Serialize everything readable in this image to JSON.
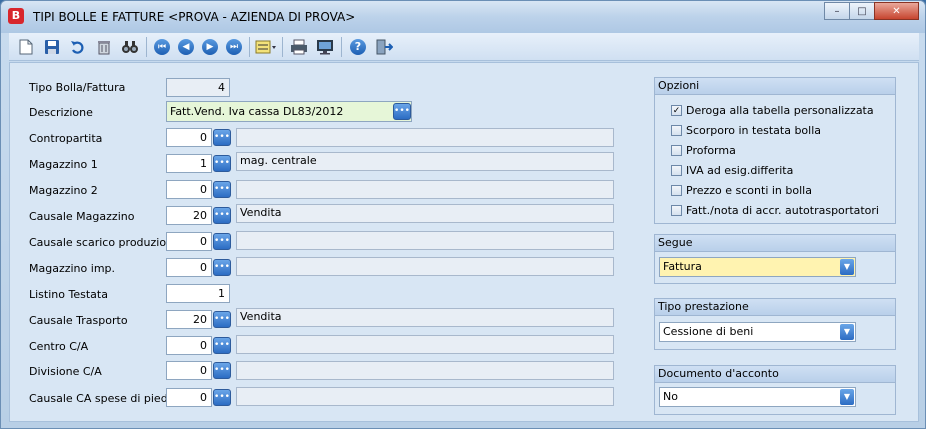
{
  "window": {
    "app_icon": "B",
    "title": "TIPI BOLLE E FATTURE <PROVA - AZIENDA DI PROVA>",
    "controls": {
      "minimize": "–",
      "maximize": "□",
      "close": "✕"
    }
  },
  "toolbar": {
    "items": [
      "new-doc-icon",
      "save-icon",
      "undo-icon",
      "delete-icon",
      "find-icon",
      "first-icon",
      "prev-icon",
      "next-icon",
      "last-icon",
      "list-icon",
      "print-icon",
      "preview-icon",
      "help-icon",
      "exit-icon"
    ],
    "glyphs": {
      "first": "⏮",
      "prev": "◀",
      "next": "▶",
      "last": "⏭",
      "help": "?"
    }
  },
  "form": {
    "tipo": {
      "label": "Tipo Bolla/Fattura",
      "value": "4"
    },
    "descrizione": {
      "label": "Descrizione",
      "value": "Fatt.Vend. Iva cassa DL83/2012"
    },
    "rows": [
      {
        "label": "Contropartita",
        "value": "0",
        "desc": ""
      },
      {
        "label": "Magazzino 1",
        "value": "1",
        "desc": "mag. centrale"
      },
      {
        "label": "Magazzino 2",
        "value": "0",
        "desc": ""
      },
      {
        "label": "Causale Magazzino",
        "value": "20",
        "desc": "Vendita"
      },
      {
        "label": "Causale scarico produzione",
        "value": "0",
        "desc": ""
      },
      {
        "label": "Magazzino imp.",
        "value": "0",
        "desc": ""
      },
      {
        "label": "Listino Testata",
        "value": "1",
        "desc": ""
      },
      {
        "label": "Causale Trasporto",
        "value": "20",
        "desc": "Vendita"
      },
      {
        "label": "Centro C/A",
        "value": "0",
        "desc": ""
      },
      {
        "label": "Divisione C/A",
        "value": "0",
        "desc": ""
      },
      {
        "label": "Causale CA spese di piede",
        "value": "0",
        "desc": ""
      }
    ],
    "lookup_glyph": "•••"
  },
  "opzioni": {
    "title": "Opzioni",
    "items": [
      {
        "label": "Deroga alla tabella personalizzata",
        "checked": true
      },
      {
        "label": "Scorporo in testata bolla",
        "checked": false
      },
      {
        "label": "Proforma",
        "checked": false
      },
      {
        "label": "IVA ad esig.differita",
        "checked": false
      },
      {
        "label": "Prezzo e sconti in bolla",
        "checked": false
      },
      {
        "label": "Fatt./nota di accr. autotrasportatori",
        "checked": false
      }
    ]
  },
  "segue": {
    "title": "Segue",
    "value": "Fattura"
  },
  "tipo_prestazione": {
    "title": "Tipo prestazione",
    "value": "Cessione di beni"
  },
  "documento_acconto": {
    "title": "Documento d'acconto",
    "value": "No"
  },
  "combo_glyph": "▼",
  "check_glyph": "✓"
}
